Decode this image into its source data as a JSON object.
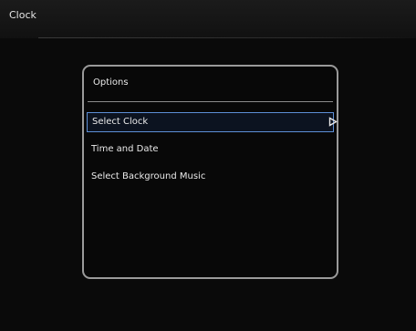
{
  "header": {
    "title": "Clock"
  },
  "options_panel": {
    "title": "Options",
    "items": [
      {
        "label": "Select Clock",
        "selected": true
      },
      {
        "label": "Time and Date",
        "selected": false
      },
      {
        "label": "Select Background Music",
        "selected": false
      }
    ]
  },
  "colors": {
    "selection_border": "#5d8fd6",
    "panel_border": "#9a9a9a"
  },
  "icons": {
    "item_arrow": "play-arrow-icon"
  }
}
